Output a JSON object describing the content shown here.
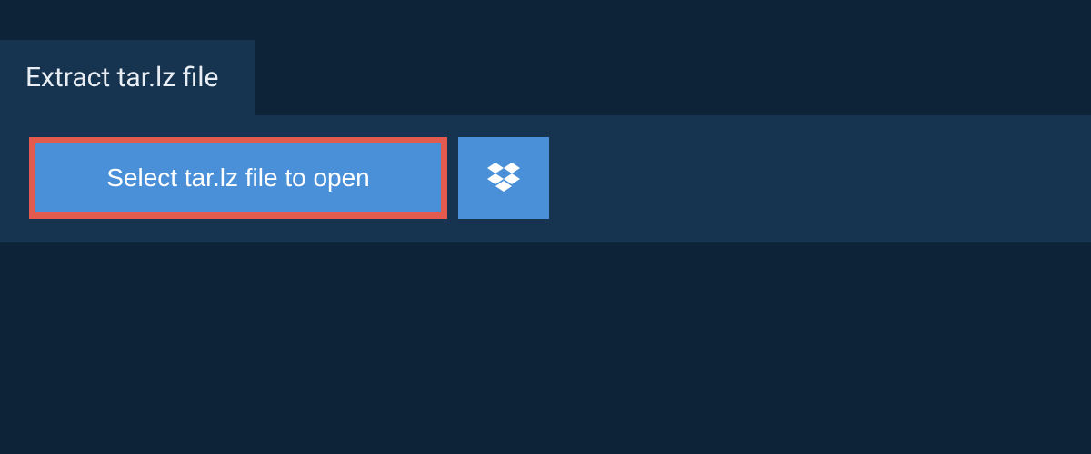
{
  "tab": {
    "title": "Extract tar.lz file"
  },
  "actions": {
    "select_file_label": "Select tar.lz file to open",
    "dropbox_icon_name": "dropbox-icon"
  },
  "colors": {
    "background": "#0d2438",
    "panel": "#163450",
    "button": "#4a90d9",
    "highlight_border": "#e35a4f",
    "text_light": "#e8eef3",
    "text_white": "#ffffff"
  }
}
